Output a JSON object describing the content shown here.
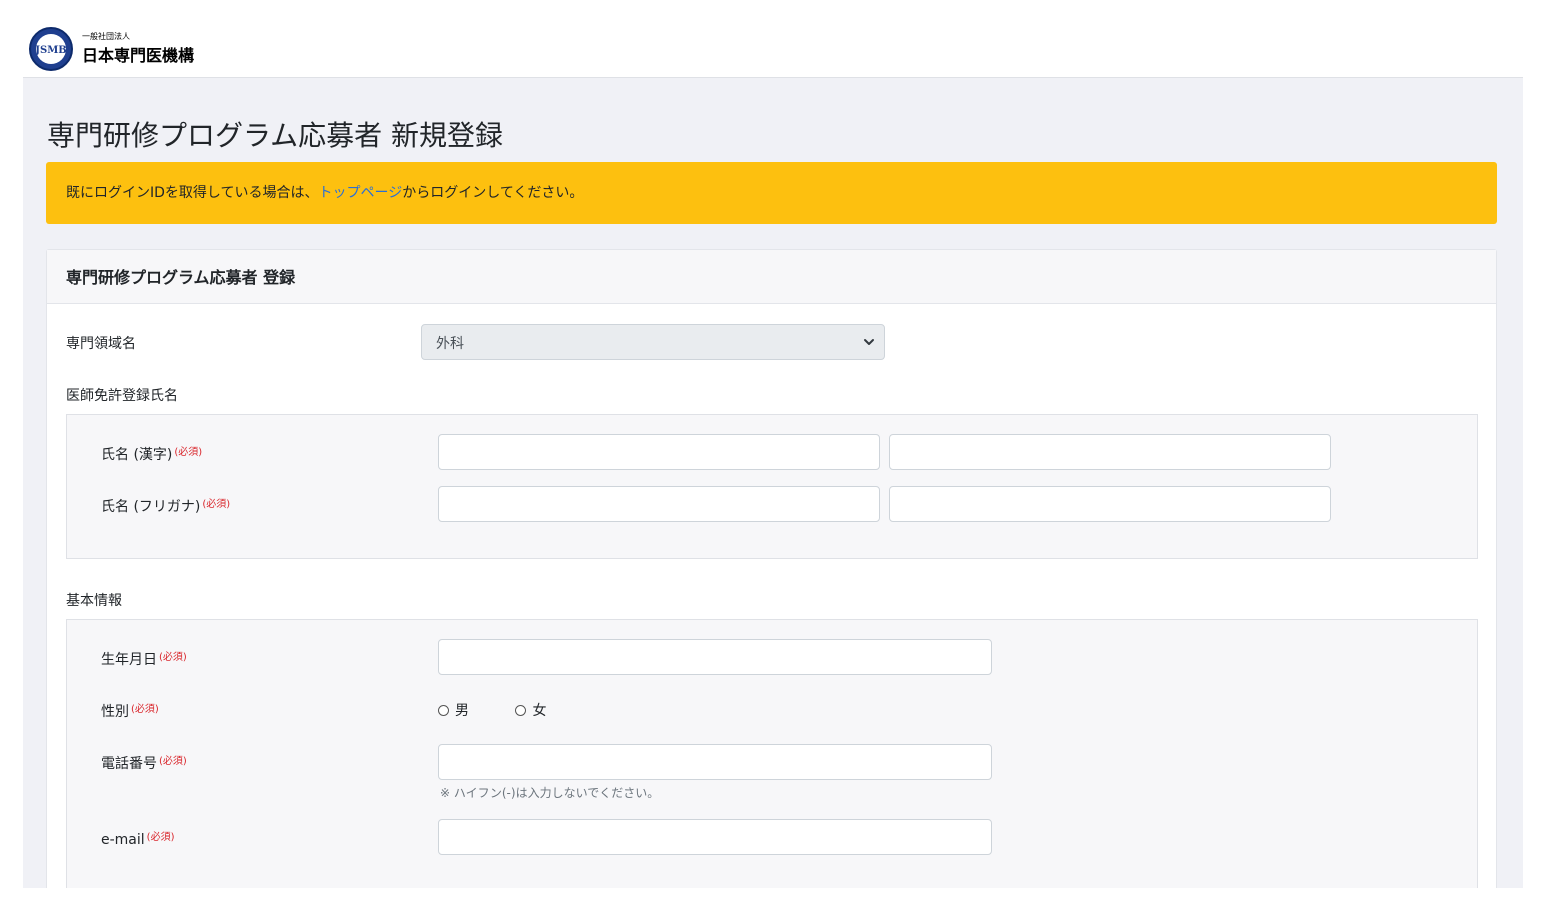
{
  "header": {
    "logo_text": "JSMB",
    "org_small": "一般社団法人",
    "org_name": "日本専門医機構"
  },
  "page": {
    "title": "専門研修プログラム応募者 新規登録"
  },
  "alert": {
    "text_before": "既にログインIDを取得している場合は、",
    "link": "トップページ",
    "text_after": "からログインしてください。"
  },
  "card": {
    "title": "専門研修プログラム応募者 登録",
    "specialty": {
      "label": "専門領域名",
      "selected": "外科"
    },
    "license_name": {
      "section_label": "医師免許登録氏名",
      "kanji_label": "氏名 (漢字)",
      "kana_label": "氏名 (フリガナ)",
      "required": "(必須)",
      "kanji_last_value": "",
      "kanji_first_value": "",
      "kana_last_value": "",
      "kana_first_value": ""
    },
    "basic_info": {
      "section_label": "基本情報",
      "birthdate_label": "生年月日",
      "gender_label": "性別",
      "gender_options": [
        "男",
        "女"
      ],
      "phone_label": "電話番号",
      "phone_hint": "※ ハイフン(-)は入力しないでください。",
      "email_label": "e-mail",
      "required": "(必須)",
      "birthdate_value": "",
      "phone_value": "",
      "email_value": ""
    }
  },
  "colors": {
    "alert_bg": "#fdc00f",
    "link": "#2a6fd6",
    "required": "#d9262c",
    "page_bg": "#f0f1f6"
  }
}
